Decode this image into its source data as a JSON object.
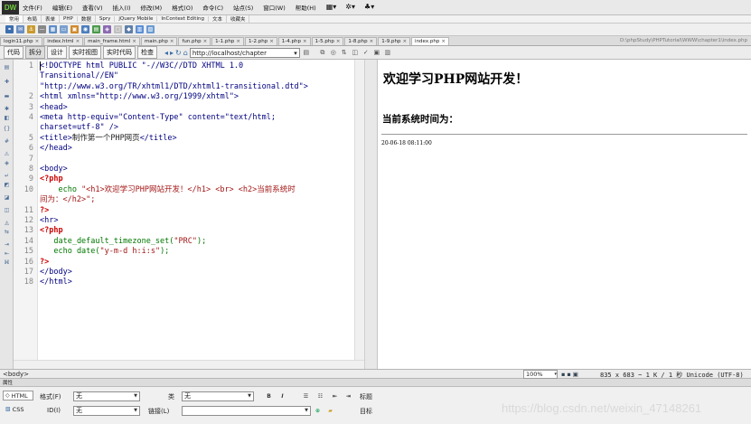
{
  "app": {
    "logo": "DW",
    "menu": [
      "文件(F)",
      "编辑(E)",
      "查看(V)",
      "插入(I)",
      "修改(M)",
      "格式(O)",
      "命令(C)",
      "站点(S)",
      "窗口(W)",
      "帮助(H)"
    ],
    "menu_icons": [
      "layout-menu-icon",
      "settings-menu-icon",
      "extensions-menu-icon"
    ],
    "menu_icon_glyphs": [
      "▦▾",
      "✲▾",
      "♣▾"
    ]
  },
  "insert_tabs": [
    "常用",
    "布局",
    "表单",
    "PHP",
    "数据",
    "Spry",
    "jQuery Mobile",
    "InContext Editing",
    "文本",
    "收藏夹"
  ],
  "insert_icons": [
    {
      "name": "hyperlink-icon",
      "color": "#3d6fb0",
      "glyph": "⚭"
    },
    {
      "name": "email-link-icon",
      "color": "#6b8fc2",
      "glyph": "✉"
    },
    {
      "name": "named-anchor-icon",
      "color": "#c99a2e",
      "glyph": "⚓"
    },
    {
      "name": "horizontal-rule-icon",
      "color": "#888888",
      "glyph": "—"
    },
    {
      "name": "table-icon",
      "color": "#5e8cc6",
      "glyph": "▦"
    },
    {
      "name": "div-icon",
      "color": "#7aa0cf",
      "glyph": "▭"
    },
    {
      "name": "images-icon",
      "color": "#d08a2b",
      "glyph": "▣"
    },
    {
      "name": "media-icon",
      "color": "#4b7fbf",
      "glyph": "◉"
    },
    {
      "name": "date-icon",
      "color": "#4b9a4b",
      "glyph": "▤"
    },
    {
      "name": "server-side-include-icon",
      "color": "#8c6bb3",
      "glyph": "◈"
    },
    {
      "name": "comment-icon",
      "color": "#c0c0c0",
      "glyph": "▢"
    },
    {
      "name": "head-icon",
      "color": "#5e7fa8",
      "glyph": "◆"
    },
    {
      "name": "script-icon",
      "color": "#5b8fd6",
      "glyph": "▥"
    },
    {
      "name": "templates-icon",
      "color": "#6b9bd2",
      "glyph": "▧"
    }
  ],
  "doc_tabs": [
    {
      "label": "login11.php",
      "active": false
    },
    {
      "label": "index.html",
      "active": false
    },
    {
      "label": "main_frame.html",
      "active": false
    },
    {
      "label": "main.php",
      "active": false
    },
    {
      "label": "fun.php",
      "active": false
    },
    {
      "label": "1-1.php",
      "active": false
    },
    {
      "label": "1-2.php",
      "active": false
    },
    {
      "label": "1-4.php",
      "active": false
    },
    {
      "label": "1-5.php",
      "active": false
    },
    {
      "label": "1-8.php",
      "active": false
    },
    {
      "label": "1-9.php",
      "active": false
    },
    {
      "label": "index.php",
      "active": true
    }
  ],
  "doc_path": "D:\\phpStudy\\PHPTutorial\\WWW\\chapter1\\index.php",
  "toolbar": {
    "views": [
      "代码",
      "拆分",
      "设计",
      "实时视图",
      "实时代码",
      "检查"
    ],
    "active_view": 1,
    "url": "http://localhost/chapter",
    "url_arrow": "▾"
  },
  "code_lines": [
    {
      "num": "1",
      "segments": [
        {
          "t": "<!DOCTYPE html PUBLIC \"-//W3C//DTD XHTML 1.0",
          "c": "c-tag"
        }
      ]
    },
    {
      "num": "",
      "segments": [
        {
          "t": "Transitional//EN\"",
          "c": "c-tag"
        }
      ]
    },
    {
      "num": "",
      "segments": [
        {
          "t": "\"http://www.w3.org/TR/xhtml1/DTD/xhtml1-transitional.dtd\">",
          "c": "c-tag"
        }
      ]
    },
    {
      "num": "2",
      "segments": [
        {
          "t": "<html xmlns=\"http://www.w3.org/1999/xhtml\">",
          "c": "c-tag"
        }
      ]
    },
    {
      "num": "3",
      "segments": [
        {
          "t": "<head>",
          "c": "c-tag"
        }
      ]
    },
    {
      "num": "4",
      "segments": [
        {
          "t": "<meta http-equiv=\"Content-Type\" content=\"text/html;",
          "c": "c-tag"
        }
      ]
    },
    {
      "num": "",
      "segments": [
        {
          "t": "charset=utf-8\" />",
          "c": "c-tag"
        }
      ]
    },
    {
      "num": "5",
      "segments": [
        {
          "t": "<title>",
          "c": "c-tag"
        },
        {
          "t": "制作第一个PHP网页",
          "c": ""
        },
        {
          "t": "</title>",
          "c": "c-tag"
        }
      ]
    },
    {
      "num": "6",
      "segments": [
        {
          "t": "</head>",
          "c": "c-tag"
        }
      ]
    },
    {
      "num": "7",
      "segments": []
    },
    {
      "num": "8",
      "segments": [
        {
          "t": "<body>",
          "c": "c-tag"
        }
      ]
    },
    {
      "num": "9",
      "segments": [
        {
          "t": "<?php",
          "c": "c-php"
        }
      ]
    },
    {
      "num": "10",
      "segments": [
        {
          "t": "    echo ",
          "c": "c-fn"
        },
        {
          "t": "\"<h1>欢迎学习PHP网站开发！</h1> <br> <h2>当前系统时",
          "c": "c-str"
        }
      ]
    },
    {
      "num": "",
      "segments": [
        {
          "t": "间为：</h2>\";",
          "c": "c-str"
        }
      ]
    },
    {
      "num": "11",
      "segments": [
        {
          "t": "?>",
          "c": "c-php"
        }
      ]
    },
    {
      "num": "12",
      "segments": [
        {
          "t": "<hr>",
          "c": "c-tag"
        }
      ]
    },
    {
      "num": "13",
      "segments": [
        {
          "t": "<?php",
          "c": "c-php"
        }
      ]
    },
    {
      "num": "14",
      "segments": [
        {
          "t": "   date_default_timezone_set(",
          "c": "c-fn"
        },
        {
          "t": "\"PRC\"",
          "c": "c-str"
        },
        {
          "t": ");",
          "c": "c-fn"
        }
      ]
    },
    {
      "num": "15",
      "segments": [
        {
          "t": "   echo date(",
          "c": "c-fn"
        },
        {
          "t": "\"y-m-d h:i:s\"",
          "c": "c-str"
        },
        {
          "t": ");",
          "c": "c-fn"
        }
      ]
    },
    {
      "num": "16",
      "segments": [
        {
          "t": "?>",
          "c": "c-php"
        }
      ]
    },
    {
      "num": "17",
      "segments": [
        {
          "t": "</body>",
          "c": "c-tag"
        }
      ]
    },
    {
      "num": "18",
      "segments": [
        {
          "t": "</html>",
          "c": "c-tag"
        }
      ]
    }
  ],
  "live_view": {
    "heading": "欢迎学习PHP网站开发！",
    "subheading": "当前系统时间为：",
    "date_output": "20-06-18 08:11:00"
  },
  "status": {
    "tag_selector": "<body>",
    "zoom": "100%",
    "info": "835 x 683 ~ 1 K / 1 秒 Unicode (UTF-8)"
  },
  "properties": {
    "title": "属性",
    "html_label": "HTML",
    "css_label": "CSS",
    "format_label": "格式(F)",
    "format_value": "无",
    "class_label": "类",
    "class_value": "无",
    "id_label": "ID(I)",
    "id_value": "无",
    "link_label": "链接(L)",
    "link_value": "",
    "title_label": "标题",
    "target_label": "目标"
  },
  "watermark": "https://blog.csdn.net/weixin_47148261"
}
